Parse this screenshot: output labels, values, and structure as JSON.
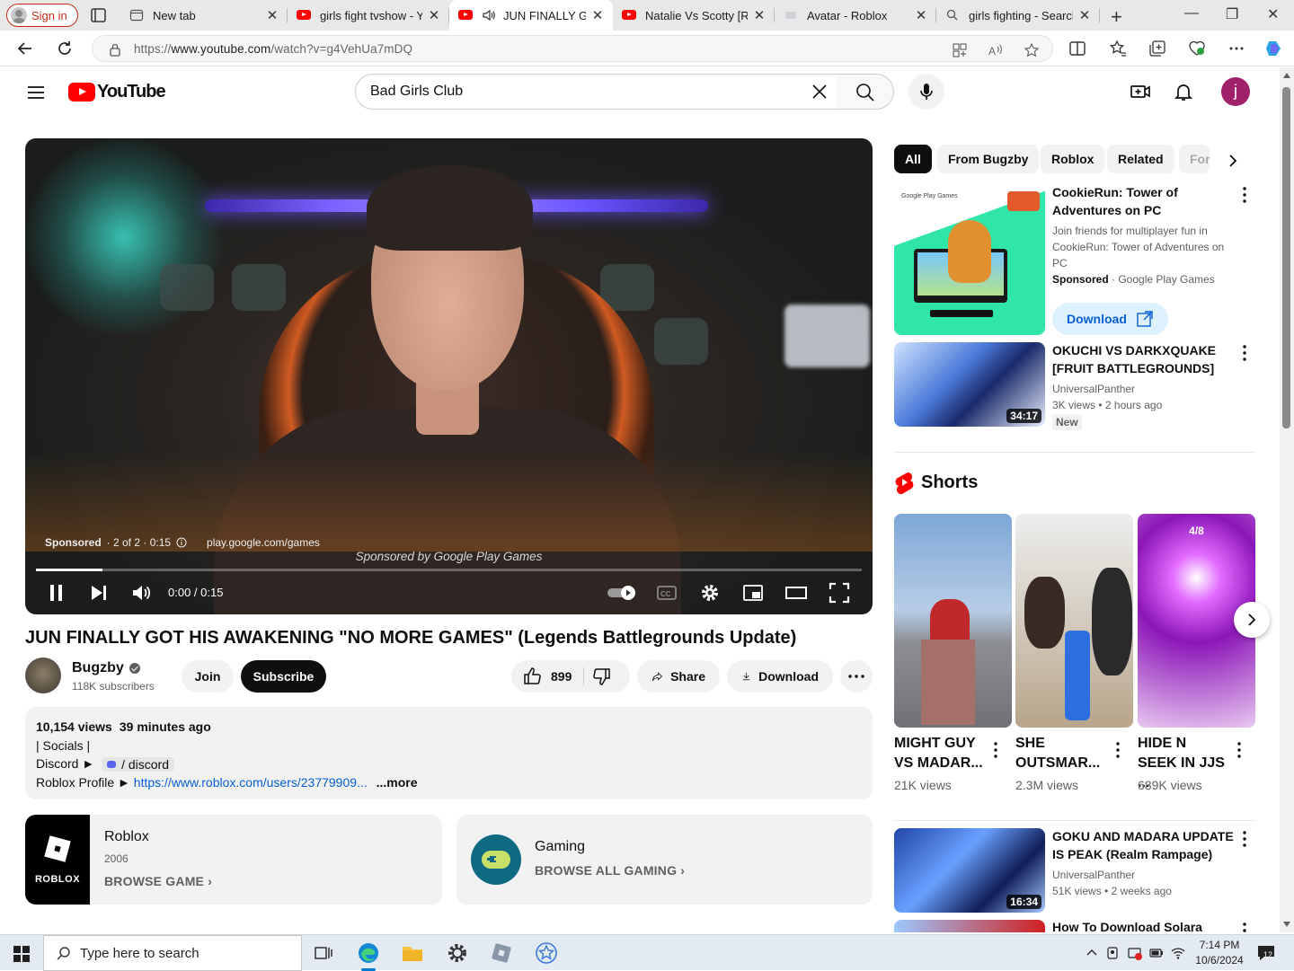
{
  "browser": {
    "signin_label": "Sign in",
    "tabs": [
      {
        "title": "New tab",
        "icon": "newtab-icon"
      },
      {
        "title": "girls fight tvshow - You",
        "icon": "youtube-icon"
      },
      {
        "title": "JUN FINALLY GOT",
        "icon": "youtube-icon",
        "active": true,
        "audio": true
      },
      {
        "title": "Natalie Vs Scotty [Rour",
        "icon": "youtube-icon"
      },
      {
        "title": "Avatar - Roblox",
        "icon": "roblox-icon"
      },
      {
        "title": "girls fighting - Search",
        "icon": "search-icon"
      }
    ],
    "url_prefix": "https://",
    "url_host": "www.youtube.com",
    "url_path": "/watch?v=g4VehUa7mDQ"
  },
  "youtube": {
    "logo_text": "YouTube",
    "search_value": "Bad Girls Club",
    "avatar_letter": "j",
    "brand_color": "#ff0000"
  },
  "player": {
    "ad_label": "Sponsored",
    "ad_count": "· 2 of 2 · 0:15",
    "ad_url": "play.google.com/games",
    "sponsored_by": "Sponsored by Google Play Games",
    "time": "0:00 / 0:15",
    "progress_fraction": 0.08
  },
  "video": {
    "title": "JUN FINALLY GOT HIS AWAKENING \"NO MORE GAMES\" (Legends Battlegrounds Update)",
    "channel": "Bugzby",
    "subscribers": "118K subscribers",
    "join_label": "Join",
    "subscribe_label": "Subscribe",
    "likes": "899",
    "share_label": "Share",
    "download_label": "Download"
  },
  "description": {
    "views": "10,154 views",
    "age": "39 minutes ago",
    "line1": "| Socials |",
    "discord_prefix": "Discord ►",
    "discord_chip": "/ discord",
    "roblox_prefix": "Roblox Profile ►",
    "roblox_link": "https://www.roblox.com/users/23779909...",
    "more_label": "...more"
  },
  "cards": {
    "game": {
      "image_label": "ROBLOX",
      "title": "Roblox",
      "year": "2006",
      "link": "BROWSE GAME"
    },
    "category": {
      "title": "Gaming",
      "link": "BROWSE ALL GAMING"
    }
  },
  "sidebar": {
    "chips": [
      "All",
      "From Bugzby",
      "Roblox",
      "Related",
      "For"
    ],
    "ad": {
      "thumb_label": "Google Play Games",
      "title": "CookieRun: Tower of Adventures on PC",
      "desc": "Join friends for multiplayer fun in CookieRun: Tower of Adventures on PC",
      "sponsored": "Sponsored",
      "advertiser": "· Google Play Games",
      "cta": "Download"
    },
    "videos": [
      {
        "title": "OKUCHI VS DARKXQUAKE [FRUIT BATTLEGROUNDS]",
        "channel": "UniversalPanther",
        "meta": "3K views • 2 hours ago",
        "badge": "New",
        "duration": "34:17"
      },
      {
        "title": "GOKU AND MADARA UPDATE IS PEAK (Realm Rampage)",
        "channel": "UniversalPanther",
        "meta": "51K views • 2 weeks ago",
        "duration": "16:34"
      },
      {
        "title": "How To Download Solara (FREE)"
      }
    ],
    "shorts_heading": "Shorts",
    "shorts": [
      {
        "title": "MIGHT GUY VS MADAR...",
        "views": "21K views"
      },
      {
        "title": "SHE OUTSMAR...",
        "views": "2.3M views"
      },
      {
        "title": "HIDE N SEEK IN JJS  ...",
        "views": "689K views",
        "overlay": "4/8"
      }
    ]
  },
  "taskbar": {
    "search_placeholder": "Type here to search",
    "time": "7:14 PM",
    "date": "10/6/2024",
    "notifications": "12"
  }
}
